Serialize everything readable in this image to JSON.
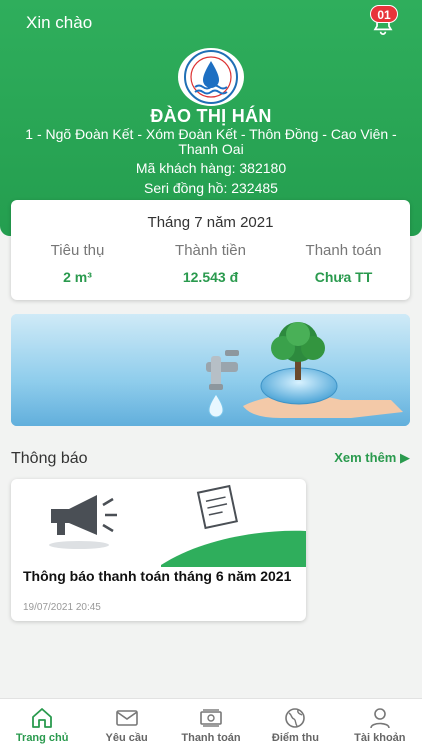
{
  "header": {
    "greeting": "Xin chào",
    "notification_count": "01",
    "customer_name": "ĐÀO THỊ HÁN",
    "address": "1 - Ngõ Đoàn Kết - Xóm Đoàn Kết - Thôn Đồng - Cao Viên - Thanh Oai",
    "customer_code": "Mã khách hàng: 382180",
    "meter_serial": "Seri đồng hồ: 232485"
  },
  "bill": {
    "period": "Tháng 7 năm 2021",
    "consumption_label": "Tiêu thụ",
    "consumption_value": "2 m³",
    "amount_label": "Thành tiền",
    "amount_value": "12.543 đ",
    "payment_label": "Thanh toán",
    "payment_value": "Chưa TT"
  },
  "notices": {
    "section_title": "Thông báo",
    "see_more": "Xem thêm",
    "items": [
      {
        "title": "Thông báo thanh toán tháng 6 năm 2021",
        "date": "19/07/2021 20:45"
      }
    ]
  },
  "nav": {
    "items": [
      {
        "label": "Trang chủ",
        "icon": "home-icon",
        "active": true
      },
      {
        "label": "Yêu cầu",
        "icon": "mail-icon",
        "active": false
      },
      {
        "label": "Thanh toán",
        "icon": "money-icon",
        "active": false
      },
      {
        "label": "Điểm thu",
        "icon": "globe-icon",
        "active": false
      },
      {
        "label": "Tài khoản",
        "icon": "user-icon",
        "active": false
      }
    ]
  },
  "colors": {
    "brand_green": "#2fae5c",
    "accent_green": "#2a9a4e",
    "badge_red": "#e8343a"
  }
}
